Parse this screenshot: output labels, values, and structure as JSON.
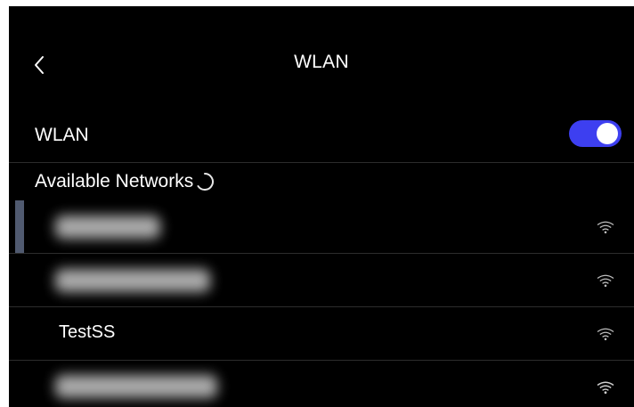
{
  "header": {
    "title": "WLAN",
    "back_icon": "chevron-left-icon"
  },
  "wlan_toggle": {
    "label": "WLAN",
    "enabled": true,
    "accent_color": "#3d3ff0"
  },
  "networks": {
    "section_label": "Available Networks",
    "loading_icon": "spinner-icon",
    "items": [
      {
        "ssid": "",
        "blurred": true,
        "selected": true,
        "signal_icon": "wifi-signal-icon"
      },
      {
        "ssid": "",
        "blurred": true,
        "selected": false,
        "signal_icon": "wifi-signal-icon"
      },
      {
        "ssid": "TestSS",
        "blurred": false,
        "selected": false,
        "signal_icon": "wifi-signal-icon"
      },
      {
        "ssid": "",
        "blurred": true,
        "selected": false,
        "signal_icon": "wifi-signal-icon"
      }
    ]
  }
}
